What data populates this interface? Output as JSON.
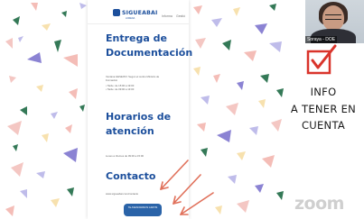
{
  "app": {
    "name": "Zoom"
  },
  "shared_screen": {
    "header": {
      "logo_text": "SIGUEABAI",
      "logo_sub": "LORENA",
      "icon_a": "Informa",
      "icon_b": "Gestió"
    },
    "sections": [
      {
        "title_line1": "Entrega de",
        "title_line2": "Documentación",
        "body": [
          "Ventana GESEIXO: Segun el centro Ministro de Formación",
          "• Tarde: de 15:00 a 19:00",
          "• Tarde: de 09:00 a 13:00"
        ]
      },
      {
        "title_line1": "Horarios de",
        "title_line2": "atención",
        "body": [
          "Lunes a Viernes de 09:00 a 15:00"
        ]
      },
      {
        "title_line1": "Contacto",
        "body": [
          "www.sigueabai.com/contacto"
        ]
      }
    ],
    "cta_button": {
      "label": "TE ASESORAMOS GRATIS"
    }
  },
  "participant": {
    "name_tag": "Soraya - DOE",
    "mic_icon": "mic-muted-icon"
  },
  "overlay": {
    "checkbox_icon": "checkbox-checked-icon",
    "info_lines": [
      "INFO",
      "A TENER EN",
      "CUENTA"
    ],
    "accent_color": "#d9342b"
  },
  "watermark": {
    "text": "zoom"
  }
}
